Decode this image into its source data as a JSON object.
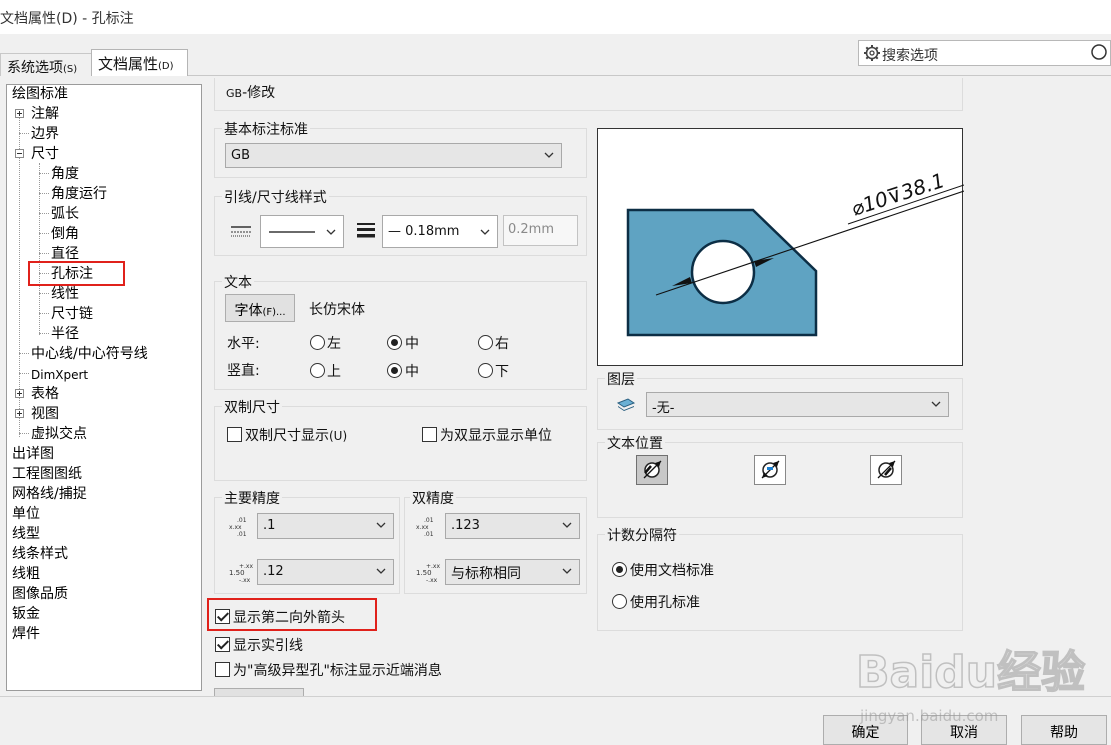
{
  "window": {
    "title": "文档属性(D) - 孔标注"
  },
  "tabs": {
    "system": "系统选项",
    "system_key": "(S)",
    "document": "文档属性",
    "document_key": "(D)"
  },
  "search": {
    "placeholder": "搜索选项"
  },
  "tree": {
    "drafting_standard": "绘图标准",
    "annotations": "注解",
    "borders": "边界",
    "dimensions": "尺寸",
    "angle": "角度",
    "angular_running": "角度运行",
    "arc_length": "弧长",
    "chamfer": "倒角",
    "diameter": "直径",
    "hole_callout": "孔标注",
    "linear": "线性",
    "ordinate": "尺寸链",
    "radius": "半径",
    "centerlines": "中心线/中心符号线",
    "dimxpert": "DimXpert",
    "tables": "表格",
    "views": "视图",
    "virtual_sharps": "虚拟交点",
    "detailing": "出详图",
    "drawing_sheets": "工程图图纸",
    "grid_snap": "网格线/捕捉",
    "units": "单位",
    "line_font": "线型",
    "line_style": "线条样式",
    "line_thickness": "线粗",
    "image_quality": "图像品质",
    "sheet_metal": "钣金",
    "weldments": "焊件"
  },
  "header": {
    "standard_modified": "GB-修改",
    "standard_prefix": "GB",
    "standard_suffix": "-修改"
  },
  "base_standard": {
    "label": "基本标注标准",
    "value": "GB"
  },
  "leader_style": {
    "label": "引线/尺寸线样式",
    "thickness": "0.18mm",
    "custom": "0.2mm"
  },
  "text": {
    "label": "文本",
    "font_button": "字体",
    "font_button_key": "(F)...",
    "font_name": "长仿宋体",
    "horizontal_label": "水平:",
    "vertical_label": "竖直:",
    "h_left": "左",
    "h_center": "中",
    "h_right": "右",
    "v_top": "上",
    "v_middle": "中",
    "v_bottom": "下",
    "horizontal_selected": "中",
    "vertical_selected": "中"
  },
  "dual": {
    "label": "双制尺寸",
    "show_dual": "双制尺寸显示",
    "show_dual_key": "(U)",
    "show_units": "为双显示显示单位",
    "show_dual_checked": false,
    "show_units_checked": false
  },
  "primary_precision": {
    "label": "主要精度",
    "value1": ".1",
    "value2": ".12"
  },
  "dual_precision": {
    "label": "双精度",
    "value1": ".123",
    "value2": "与标称相同"
  },
  "options": {
    "second_outside_arrow": "显示第二向外箭头",
    "solid_leader": "显示实引线",
    "near_side_message": "为\"高级异型孔\"标注显示近端消息",
    "second_outside_arrow_checked": true,
    "solid_leader_checked": true,
    "near_side_message_checked": false
  },
  "preview": {
    "callout_text": "⌀10⊽38.1"
  },
  "layer": {
    "label": "图层",
    "value": "-无-"
  },
  "text_position": {
    "label": "文本位置"
  },
  "count_separator": {
    "label": "计数分隔符",
    "use_document": "使用文档标准",
    "use_hole": "使用孔标准",
    "selected": "使用文档标准"
  },
  "buttons": {
    "ok": "确定",
    "cancel": "取消",
    "help": "帮助"
  },
  "watermark": {
    "text": "Baidu经验",
    "url": "jingyan.baidu.com"
  },
  "colors": {
    "part_fill": "#5fa3c2",
    "part_stroke": "#0c2e45",
    "highlight": "#e0211b"
  }
}
